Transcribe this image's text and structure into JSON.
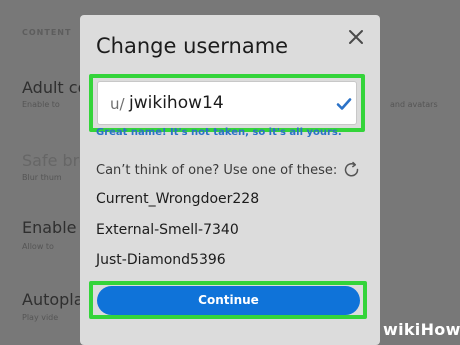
{
  "background": {
    "section_label": "CONTENT",
    "items": [
      {
        "label": "Adult co",
        "sub": "Enable to",
        "right_sub": "and avatars"
      },
      {
        "label": "Safe bro",
        "sub": "Blur thum",
        "right_sub": ""
      },
      {
        "label": "Enable",
        "sub": "Allow to",
        "right_sub": ""
      },
      {
        "label": "Autopla",
        "sub": "Play vide",
        "right_sub": ""
      }
    ]
  },
  "modal": {
    "title": "Change username",
    "close_icon": "close-icon",
    "username": {
      "prefix": "u/",
      "value": "jwikihow14",
      "status_icon": "checkmark-icon"
    },
    "hint": "Great name! It's not taken, so it's all yours.",
    "suggestions_label": "Can’t think of one? Use one of these:",
    "refresh_icon": "refresh-icon",
    "suggestions": [
      "Current_Wrongdoer228",
      "External-Smell-7340",
      "Just-Diamond5396"
    ],
    "continue_label": "Continue"
  },
  "colors": {
    "highlight": "#34d43a",
    "accent": "#0f73d9",
    "hint": "#2b72c7",
    "modal_bg": "#dcdcdc"
  },
  "watermark": "wikiHow"
}
